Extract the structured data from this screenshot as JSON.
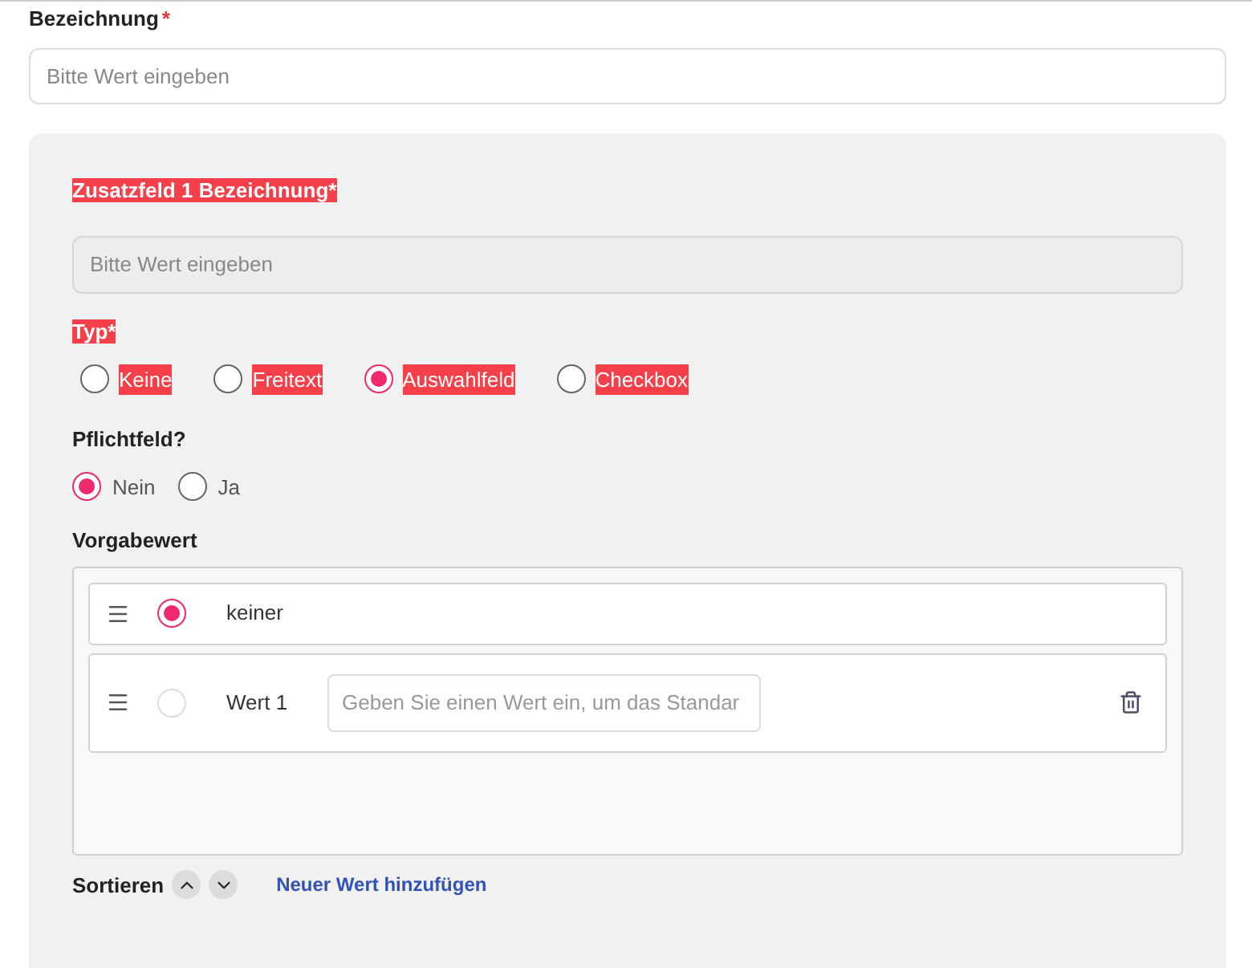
{
  "name_field": {
    "label": "Bezeichnung",
    "required_mark": "*",
    "placeholder": "Bitte Wert eingeben"
  },
  "extra_field": {
    "label": {
      "text": "Zusatzfeld 1 Bezeichnung*",
      "highlighted": true
    },
    "placeholder": "Bitte Wert eingeben",
    "type": {
      "label": {
        "text": "Typ*",
        "highlighted": true
      },
      "options": [
        {
          "label": "Keine",
          "selected": false,
          "highlighted": true
        },
        {
          "label": "Freitext",
          "selected": false,
          "highlighted": true
        },
        {
          "label": "Auswahlfeld",
          "selected": true,
          "highlighted": true
        },
        {
          "label": "Checkbox",
          "selected": false,
          "highlighted": true
        }
      ]
    },
    "required": {
      "label": "Pflichtfeld?",
      "options": [
        {
          "label": "Nein",
          "selected": true
        },
        {
          "label": "Ja",
          "selected": false
        }
      ]
    },
    "default_value": {
      "label": "Vorgabewert",
      "rows": [
        {
          "kind": "none",
          "label": "keiner",
          "selected": true
        },
        {
          "kind": "value",
          "label": "Wert 1",
          "selected": false,
          "placeholder": "Geben Sie einen Wert ein, um das Standar"
        }
      ]
    },
    "footer": {
      "sort_label": "Sortieren",
      "add_link": "Neuer Wert hinzufügen"
    }
  }
}
